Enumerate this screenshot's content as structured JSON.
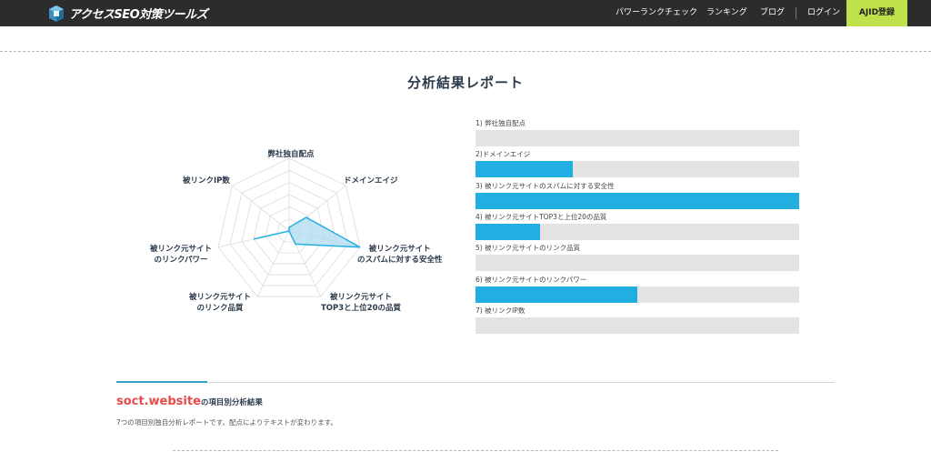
{
  "header": {
    "logo_text": "アクセスSEO対策ツールズ",
    "nav": [
      "パワーランクチェック",
      "ランキング",
      "ブログ",
      "ログイン"
    ],
    "register_label": "AJID登録"
  },
  "page_title": "分析結果レポート",
  "radar": {
    "labels": [
      [
        "弊社独自配点"
      ],
      [
        "ドメインエイジ"
      ],
      [
        "被リンク元サイト",
        "のスパムに対する安全性"
      ],
      [
        "被リンク元サイト",
        "TOP3と上位20の品質"
      ],
      [
        "被リンク元サイト",
        "のリンク品質"
      ],
      [
        "被リンク元サイト",
        "のリンクパワー"
      ],
      [
        "被リンクIP数"
      ]
    ],
    "values": [
      0.05,
      0.3,
      1.0,
      0.2,
      0.0,
      0.5,
      0.0
    ],
    "fill_color": "#a9d9ee",
    "stroke_color": "#29aee0"
  },
  "bars": {
    "color": "#21aee1",
    "items": [
      {
        "label": "1) 弊社独自配点",
        "value": 0.0
      },
      {
        "label": "2)ドメインエイジ",
        "value": 0.3
      },
      {
        "label": "3) 被リンク元サイトのスパムに対する安全性",
        "value": 1.0
      },
      {
        "label": "4) 被リンク元サイトTOP3と上位20の品質",
        "value": 0.2
      },
      {
        "label": "5) 被リンク元サイトのリンク品質",
        "value": 0.0
      },
      {
        "label": "6) 被リンク元サイトのリンクパワー",
        "value": 0.5
      },
      {
        "label": "7) 被リンクIP数",
        "value": 0.0
      }
    ]
  },
  "section": {
    "site_name": "soct.website",
    "title_suffix": "の項目別分析結果",
    "description": "7つの項目別独自分析レポートです。配点によりテキストが変わります。"
  }
}
